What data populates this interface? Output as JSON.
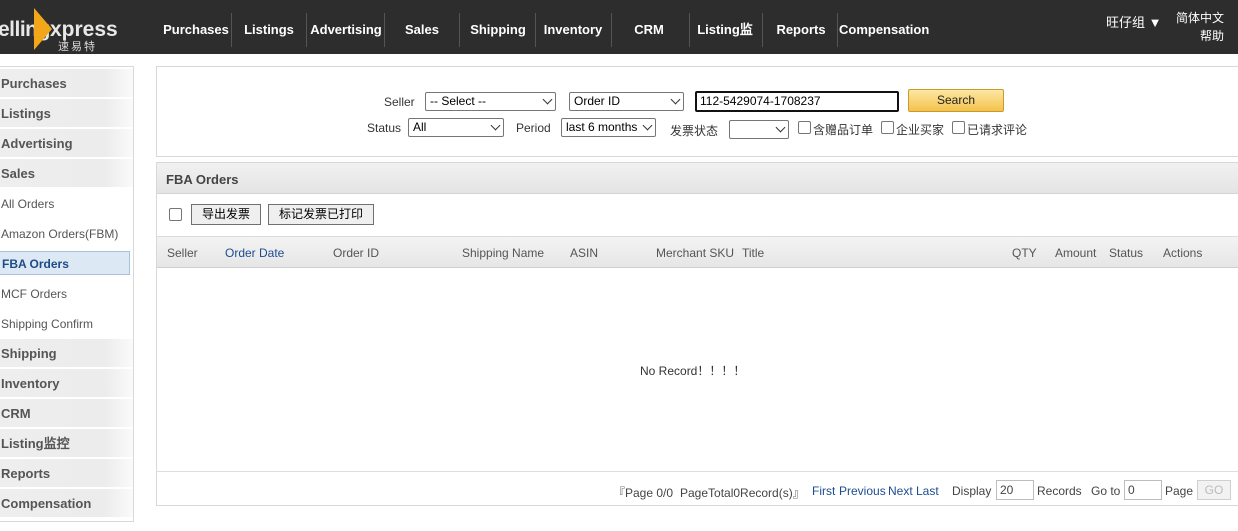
{
  "app": {
    "logo_text_left": "elling",
    "logo_text_right": "xpress",
    "logo_sub": "速易特",
    "brand_color": "#f2a71b"
  },
  "nav": {
    "items": [
      {
        "label": "Purchases"
      },
      {
        "label": "Listings"
      },
      {
        "label": "Advertising"
      },
      {
        "label": "Sales"
      },
      {
        "label": "Shipping"
      },
      {
        "label": "Inventory"
      },
      {
        "label": "CRM"
      },
      {
        "label": "Listing监控"
      },
      {
        "label": "Reports"
      },
      {
        "label": "Compensation"
      }
    ],
    "user": "旺仔组 ▼",
    "language": "简体中文",
    "help": "帮助"
  },
  "sidebar": {
    "items": [
      {
        "label": "Purchases"
      },
      {
        "label": "Listings"
      },
      {
        "label": "Advertising"
      },
      {
        "label": "Sales"
      },
      {
        "label": "All Orders"
      },
      {
        "label": "Amazon Orders(FBM)"
      },
      {
        "label": "FBA Orders"
      },
      {
        "label": "MCF Orders"
      },
      {
        "label": "Shipping Confirm"
      },
      {
        "label": "Shipping"
      },
      {
        "label": "Inventory"
      },
      {
        "label": "CRM"
      },
      {
        "label": "Listing监控"
      },
      {
        "label": "Reports"
      },
      {
        "label": "Compensation"
      }
    ],
    "active": "FBA Orders"
  },
  "search": {
    "seller_label": "Seller",
    "seller_value": "-- Select --",
    "field_value": "Order ID",
    "query_value": "112-5429074-1708237",
    "search_button": "Search",
    "status_label": "Status",
    "status_value": "All",
    "period_label": "Period",
    "period_value": "last 6 months",
    "invoice_status_label": "发票状态",
    "invoice_status_value": "",
    "cb_gift": "含赠品订单",
    "cb_business": "企业买家",
    "cb_review": "已请求评论"
  },
  "orders": {
    "title": "FBA Orders",
    "export_invoice": "导出发票",
    "mark_printed": "标记发票已打印",
    "columns": [
      "Seller",
      "Order Date",
      "Order ID",
      "Shipping Name",
      "ASIN",
      "Merchant SKU",
      "Title",
      "QTY",
      "Amount",
      "Status",
      "Actions"
    ],
    "empty_text": "No Record！！！！",
    "pager": {
      "page_info": "『Page 0/0",
      "page_total": "PageTotal0Record(s)』",
      "first": "First",
      "previous": "Previous",
      "next": "Next",
      "last": "Last",
      "display_label": "Display",
      "display_value": "20",
      "records_label": "Records",
      "goto_label": "Go to",
      "goto_value": "0",
      "page_label": "Page",
      "go_button": "GO"
    }
  }
}
